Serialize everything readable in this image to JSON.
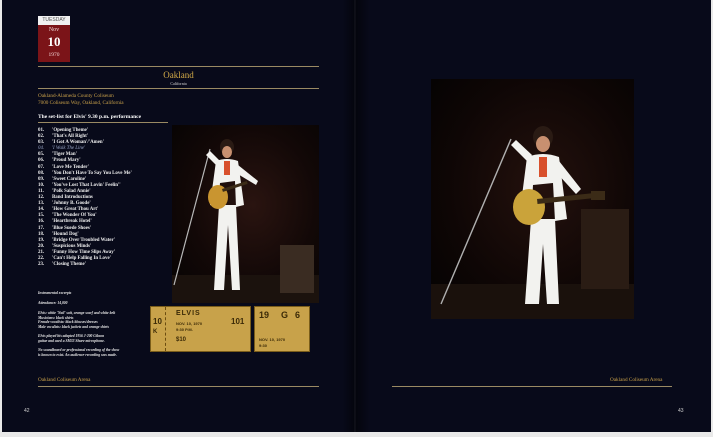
{
  "date_box": {
    "weekday": "TUESDAY",
    "month": "Nov",
    "day": "10",
    "year": "1970"
  },
  "city": "Oakland",
  "state": "California",
  "venue": {
    "name": "Oakland-Alameda County Coliseum",
    "address": "7000 Coliseum Way, Oakland, California"
  },
  "setlist_title": "The set-list for Elvis' 9.30 p.m. performance",
  "setlist": [
    {
      "n": "01.",
      "song": "'Opening Theme'"
    },
    {
      "n": "02.",
      "song": "'That's All Right'"
    },
    {
      "n": "03.",
      "song": "'I Got A Woman'/'Amen'"
    },
    {
      "n": "04.",
      "song": "'I Walk The Line'"
    },
    {
      "n": "05.",
      "song": "'Tiger Man'"
    },
    {
      "n": "06.",
      "song": "'Proud Mary'"
    },
    {
      "n": "07.",
      "song": "'Love Me Tender'"
    },
    {
      "n": "08.",
      "song": "'You Don't Have To Say You Love Me'"
    },
    {
      "n": "09.",
      "song": "'Sweet Caroline'"
    },
    {
      "n": "10.",
      "song": "'You've Lost That Lovin' Feelin''"
    },
    {
      "n": "11.",
      "song": "'Polk Salad Annie'"
    },
    {
      "n": "12.",
      "song": "Band Introductions"
    },
    {
      "n": "13.",
      "song": "'Johnny B. Goode'"
    },
    {
      "n": "14.",
      "song": "'How Great Thou Art'"
    },
    {
      "n": "15.",
      "song": "'The Wonder Of You'"
    },
    {
      "n": "16.",
      "song": "'Heartbreak Hotel'"
    },
    {
      "n": "17.",
      "song": "'Blue Suede Shoes'"
    },
    {
      "n": "18.",
      "song": "'Hound Dog'"
    },
    {
      "n": "19.",
      "song": "'Bridge Over Troubled Water'"
    },
    {
      "n": "20.",
      "song": "'Suspicious Minds'"
    },
    {
      "n": "21.",
      "song": "'Funny How Time Slips Away'"
    },
    {
      "n": "22.",
      "song": "'Can't Help Falling In Love'"
    },
    {
      "n": "23.",
      "song": "'Closing Theme'"
    }
  ],
  "notes": {
    "instrumental": "Instrumental excerpts",
    "attendance": "Attendance: 14,000",
    "outfits": [
      "Elvis: white 'Nail' suit, orange scarf and white belt",
      "Musicians: black shirts",
      "Female vocalists: black blouses/dresses",
      "Male vocalists: black jackets and orange shirts"
    ],
    "guitar": [
      "Elvis played his adapted 1956 J-200 Gibson",
      "guitar and used a SM33 Shure microphone."
    ],
    "recording": [
      "No soundboard or professional recording of the show",
      "is known to exist. An audience-recording was made."
    ]
  },
  "tickets": {
    "t1": {
      "artist": "ELVIS",
      "date": "NOV. 10, 1970",
      "time": "9:30 P.M.",
      "row": "10",
      "seat": "K",
      "section": "101",
      "price": "$10"
    },
    "t2": {
      "section": "19",
      "seat": "G",
      "row": "6",
      "date": "NOV. 10, 1970",
      "time": "9:30"
    }
  },
  "footer_left": "Oakland Coliseum Arena",
  "footer_right": "Oakland Coliseum Arena",
  "page_left": "42",
  "page_right": "43",
  "colors": {
    "accent": "#c8a04a",
    "date_red": "#7b1418",
    "background": "#080a1a"
  }
}
